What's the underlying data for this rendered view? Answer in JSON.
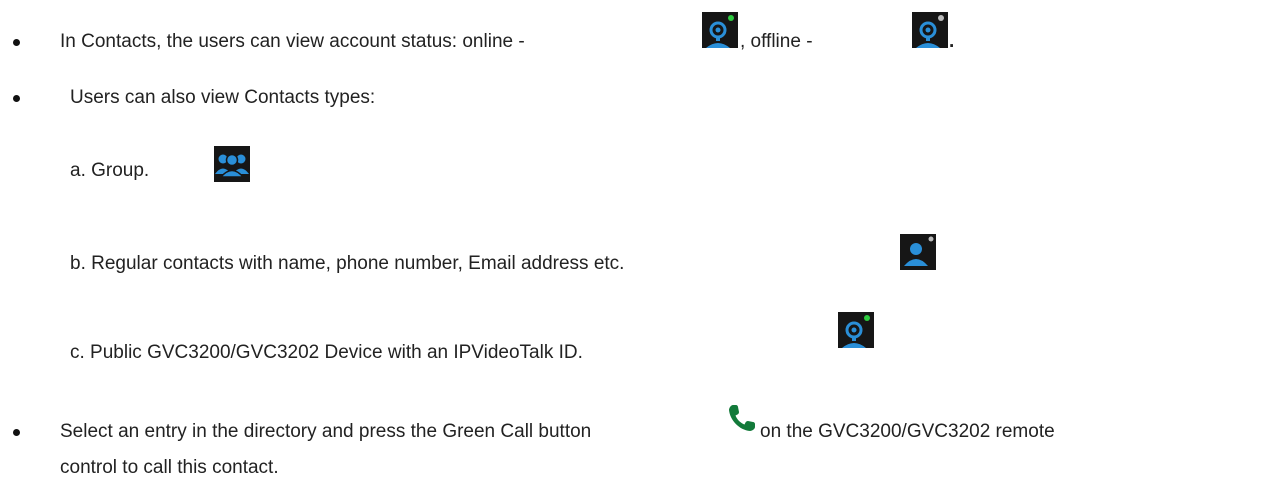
{
  "doc": {
    "line1": {
      "text_a": "In Contacts, the users can view account status: online - ",
      "text_b": ", offline - ",
      "text_c": "."
    },
    "line2": "Users can also view Contacts types:",
    "item_a": "a. Group.",
    "item_b": "b. Regular contacts with name, phone number, Email address etc.",
    "item_c": "c. Public GVC3200/GVC3202 Device with an IPVideoTalk ID.",
    "line3": {
      "text_a": "Select an entry in the directory and press the Green Call button",
      "text_b": "on the GVC3200/GVC3202 remote",
      "text_c": "control to call this contact."
    }
  },
  "icons": {
    "online": "device-online-icon",
    "offline": "device-offline-icon",
    "group": "group-contact-icon",
    "regular": "regular-contact-icon",
    "public_device": "public-device-icon",
    "call": "green-call-icon"
  },
  "colors": {
    "icon_blue": "#2a8fd8",
    "icon_bg": "#161616",
    "online_dot": "#2ecc40",
    "offline_dot": "#bbbbbb",
    "call_green": "#137a3a"
  }
}
